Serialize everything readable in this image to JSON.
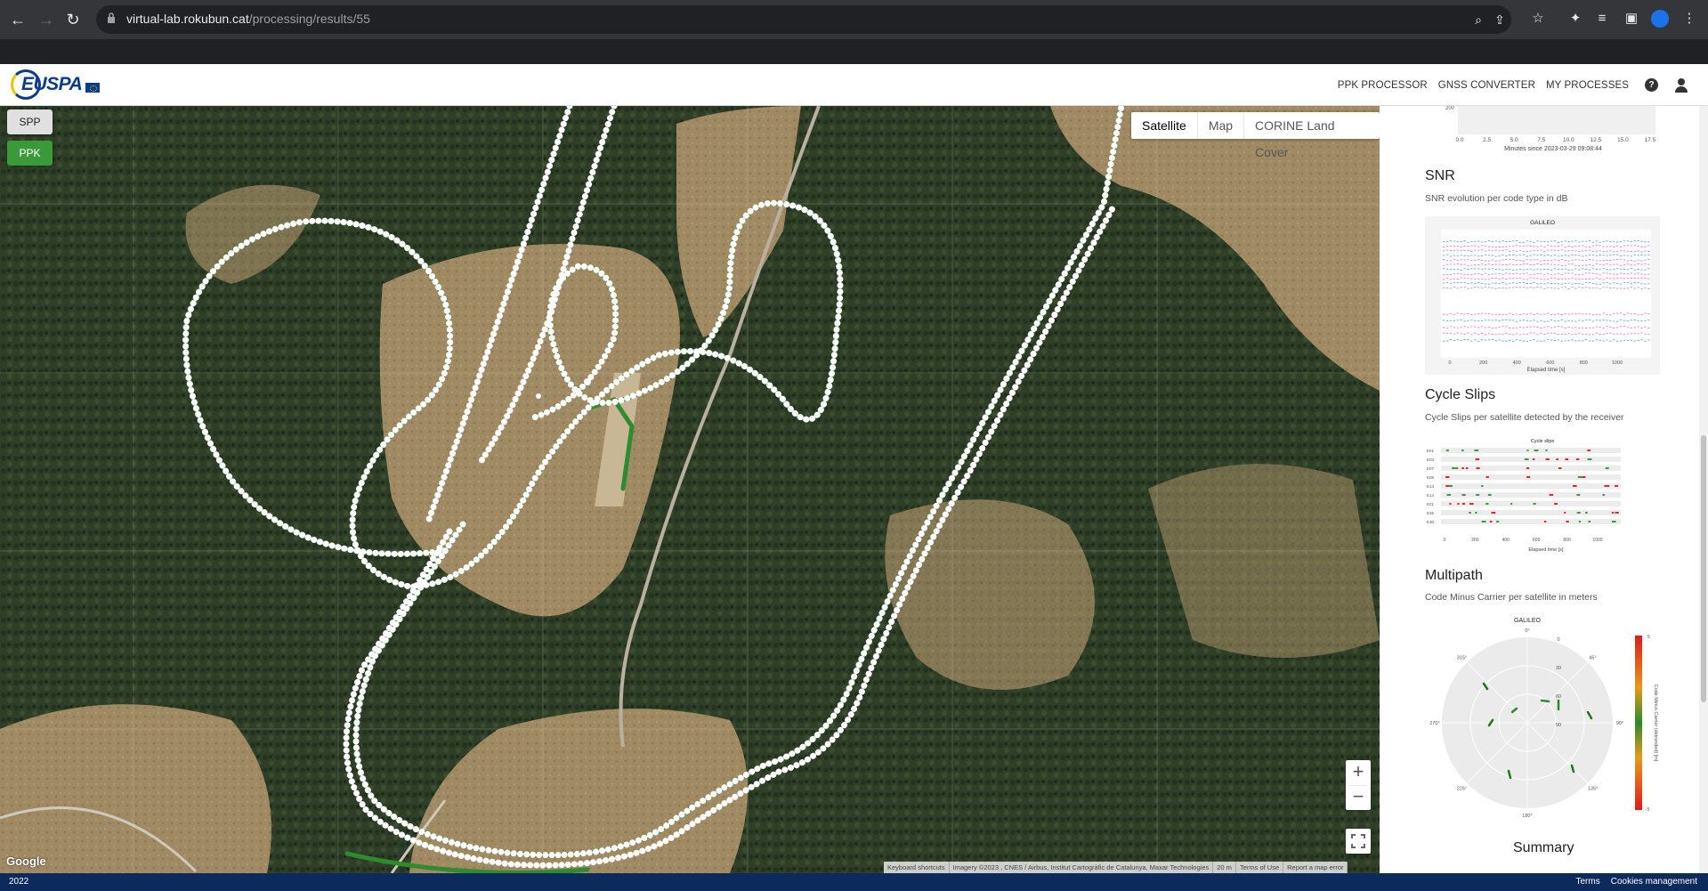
{
  "browser": {
    "url_host": "virtual-lab.rokubun.cat",
    "url_path": "/processing/results/55"
  },
  "header": {
    "nav": [
      "PPK PROCESSOR",
      "GNSS CONVERTER",
      "MY PROCESSES"
    ],
    "help": "?"
  },
  "map": {
    "modes": {
      "spp": "SPP",
      "ppk": "PPK"
    },
    "map_types": [
      "Satellite",
      "Map",
      "CORINE Land Cover"
    ],
    "zoom_in": "+",
    "zoom_out": "−",
    "google": "Google",
    "attribution": [
      "Keyboard shortcuts",
      "Imagery ©2023 , CNES / Airbus, Institut Cartogràfic de Catalunya, Maxar Technologies",
      "20 m",
      "Terms of Use",
      "Report a map error"
    ],
    "colors": {
      "track_fixed": "#2e8b2e",
      "track_float": "#ffffff"
    }
  },
  "panel": {
    "top_plot": {
      "y_tick": "200",
      "x_ticks": [
        "0.0",
        "2.5",
        "5.0",
        "7.5",
        "10.0",
        "12.5",
        "15.0",
        "17.5"
      ],
      "xlabel": "Minutes since 2023-03-29 09:08:44"
    },
    "snr": {
      "title": "SNR",
      "subtitle": "SNR evolution per code type in dB",
      "chart_title": "GALILEO",
      "xlabel": "Elapsed time [s]",
      "x_ticks": [
        "0",
        "200",
        "400",
        "600",
        "800",
        "1000"
      ]
    },
    "cycle_slips": {
      "title": "Cycle Slips",
      "subtitle": "Cycle Slips per satellite detected by the receiver",
      "chart_title": "Cycle slips",
      "xlabel": "Elapsed time [s]",
      "satellites": [
        "E01",
        "E03",
        "E07",
        "E08",
        "E13",
        "E14",
        "E21",
        "E26",
        "E30"
      ],
      "x_ticks": [
        "0",
        "200",
        "400",
        "600",
        "800",
        "1000"
      ]
    },
    "multipath": {
      "title": "Multipath",
      "subtitle": "Code Minus Carrier per satellite in meters",
      "chart_title": "GALILEO",
      "angles": [
        "0°",
        "45°",
        "90°",
        "135°",
        "180°",
        "225°",
        "270°",
        "315°"
      ],
      "radial": [
        "0",
        "30",
        "60",
        "90"
      ],
      "colorbar_label": "Code Minus Carrier (detrended) [m]",
      "colorbar_max": "5",
      "colorbar_min": "-5"
    },
    "summary": "Summary"
  },
  "footer": {
    "year": "2022",
    "links": [
      "Terms",
      "Cookies management"
    ]
  }
}
